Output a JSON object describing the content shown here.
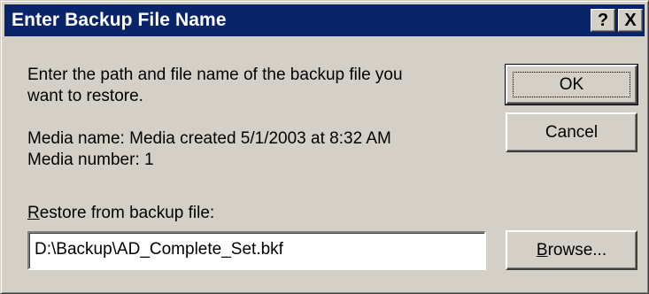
{
  "window": {
    "title": "Enter Backup File Name",
    "help_glyph": "?",
    "close_glyph": "X"
  },
  "body": {
    "instruction_line1": "Enter the path and file name of the backup file you",
    "instruction_line2": "want to restore.",
    "media_name": "Media name: Media created 5/1/2003 at 8:32 AM",
    "media_number": "Media number: 1",
    "restore_label_accel": "R",
    "restore_label_rest": "estore from backup file:",
    "restore_path": "D:\\Backup\\AD_Complete_Set.bkf"
  },
  "buttons": {
    "ok": "OK",
    "cancel": "Cancel",
    "browse_accel": "B",
    "browse_rest": "rowse..."
  },
  "colors": {
    "titlebar": "#0a246a",
    "face": "#d4d0c8"
  }
}
